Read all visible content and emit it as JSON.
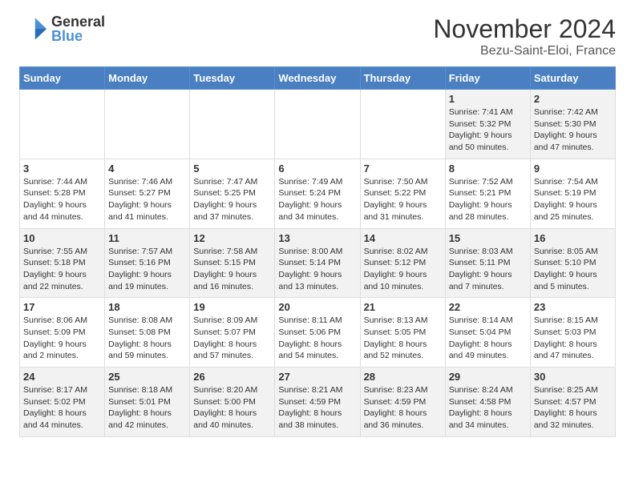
{
  "header": {
    "logo_general": "General",
    "logo_blue": "Blue",
    "month_title": "November 2024",
    "location": "Bezu-Saint-Eloi, France"
  },
  "days_of_week": [
    "Sunday",
    "Monday",
    "Tuesday",
    "Wednesday",
    "Thursday",
    "Friday",
    "Saturday"
  ],
  "weeks": [
    [
      {
        "day": "",
        "info": ""
      },
      {
        "day": "",
        "info": ""
      },
      {
        "day": "",
        "info": ""
      },
      {
        "day": "",
        "info": ""
      },
      {
        "day": "",
        "info": ""
      },
      {
        "day": "1",
        "info": "Sunrise: 7:41 AM\nSunset: 5:32 PM\nDaylight: 9 hours and 50 minutes."
      },
      {
        "day": "2",
        "info": "Sunrise: 7:42 AM\nSunset: 5:30 PM\nDaylight: 9 hours and 47 minutes."
      }
    ],
    [
      {
        "day": "3",
        "info": "Sunrise: 7:44 AM\nSunset: 5:28 PM\nDaylight: 9 hours and 44 minutes."
      },
      {
        "day": "4",
        "info": "Sunrise: 7:46 AM\nSunset: 5:27 PM\nDaylight: 9 hours and 41 minutes."
      },
      {
        "day": "5",
        "info": "Sunrise: 7:47 AM\nSunset: 5:25 PM\nDaylight: 9 hours and 37 minutes."
      },
      {
        "day": "6",
        "info": "Sunrise: 7:49 AM\nSunset: 5:24 PM\nDaylight: 9 hours and 34 minutes."
      },
      {
        "day": "7",
        "info": "Sunrise: 7:50 AM\nSunset: 5:22 PM\nDaylight: 9 hours and 31 minutes."
      },
      {
        "day": "8",
        "info": "Sunrise: 7:52 AM\nSunset: 5:21 PM\nDaylight: 9 hours and 28 minutes."
      },
      {
        "day": "9",
        "info": "Sunrise: 7:54 AM\nSunset: 5:19 PM\nDaylight: 9 hours and 25 minutes."
      }
    ],
    [
      {
        "day": "10",
        "info": "Sunrise: 7:55 AM\nSunset: 5:18 PM\nDaylight: 9 hours and 22 minutes."
      },
      {
        "day": "11",
        "info": "Sunrise: 7:57 AM\nSunset: 5:16 PM\nDaylight: 9 hours and 19 minutes."
      },
      {
        "day": "12",
        "info": "Sunrise: 7:58 AM\nSunset: 5:15 PM\nDaylight: 9 hours and 16 minutes."
      },
      {
        "day": "13",
        "info": "Sunrise: 8:00 AM\nSunset: 5:14 PM\nDaylight: 9 hours and 13 minutes."
      },
      {
        "day": "14",
        "info": "Sunrise: 8:02 AM\nSunset: 5:12 PM\nDaylight: 9 hours and 10 minutes."
      },
      {
        "day": "15",
        "info": "Sunrise: 8:03 AM\nSunset: 5:11 PM\nDaylight: 9 hours and 7 minutes."
      },
      {
        "day": "16",
        "info": "Sunrise: 8:05 AM\nSunset: 5:10 PM\nDaylight: 9 hours and 5 minutes."
      }
    ],
    [
      {
        "day": "17",
        "info": "Sunrise: 8:06 AM\nSunset: 5:09 PM\nDaylight: 9 hours and 2 minutes."
      },
      {
        "day": "18",
        "info": "Sunrise: 8:08 AM\nSunset: 5:08 PM\nDaylight: 8 hours and 59 minutes."
      },
      {
        "day": "19",
        "info": "Sunrise: 8:09 AM\nSunset: 5:07 PM\nDaylight: 8 hours and 57 minutes."
      },
      {
        "day": "20",
        "info": "Sunrise: 8:11 AM\nSunset: 5:06 PM\nDaylight: 8 hours and 54 minutes."
      },
      {
        "day": "21",
        "info": "Sunrise: 8:13 AM\nSunset: 5:05 PM\nDaylight: 8 hours and 52 minutes."
      },
      {
        "day": "22",
        "info": "Sunrise: 8:14 AM\nSunset: 5:04 PM\nDaylight: 8 hours and 49 minutes."
      },
      {
        "day": "23",
        "info": "Sunrise: 8:15 AM\nSunset: 5:03 PM\nDaylight: 8 hours and 47 minutes."
      }
    ],
    [
      {
        "day": "24",
        "info": "Sunrise: 8:17 AM\nSunset: 5:02 PM\nDaylight: 8 hours and 44 minutes."
      },
      {
        "day": "25",
        "info": "Sunrise: 8:18 AM\nSunset: 5:01 PM\nDaylight: 8 hours and 42 minutes."
      },
      {
        "day": "26",
        "info": "Sunrise: 8:20 AM\nSunset: 5:00 PM\nDaylight: 8 hours and 40 minutes."
      },
      {
        "day": "27",
        "info": "Sunrise: 8:21 AM\nSunset: 4:59 PM\nDaylight: 8 hours and 38 minutes."
      },
      {
        "day": "28",
        "info": "Sunrise: 8:23 AM\nSunset: 4:59 PM\nDaylight: 8 hours and 36 minutes."
      },
      {
        "day": "29",
        "info": "Sunrise: 8:24 AM\nSunset: 4:58 PM\nDaylight: 8 hours and 34 minutes."
      },
      {
        "day": "30",
        "info": "Sunrise: 8:25 AM\nSunset: 4:57 PM\nDaylight: 8 hours and 32 minutes."
      }
    ]
  ]
}
